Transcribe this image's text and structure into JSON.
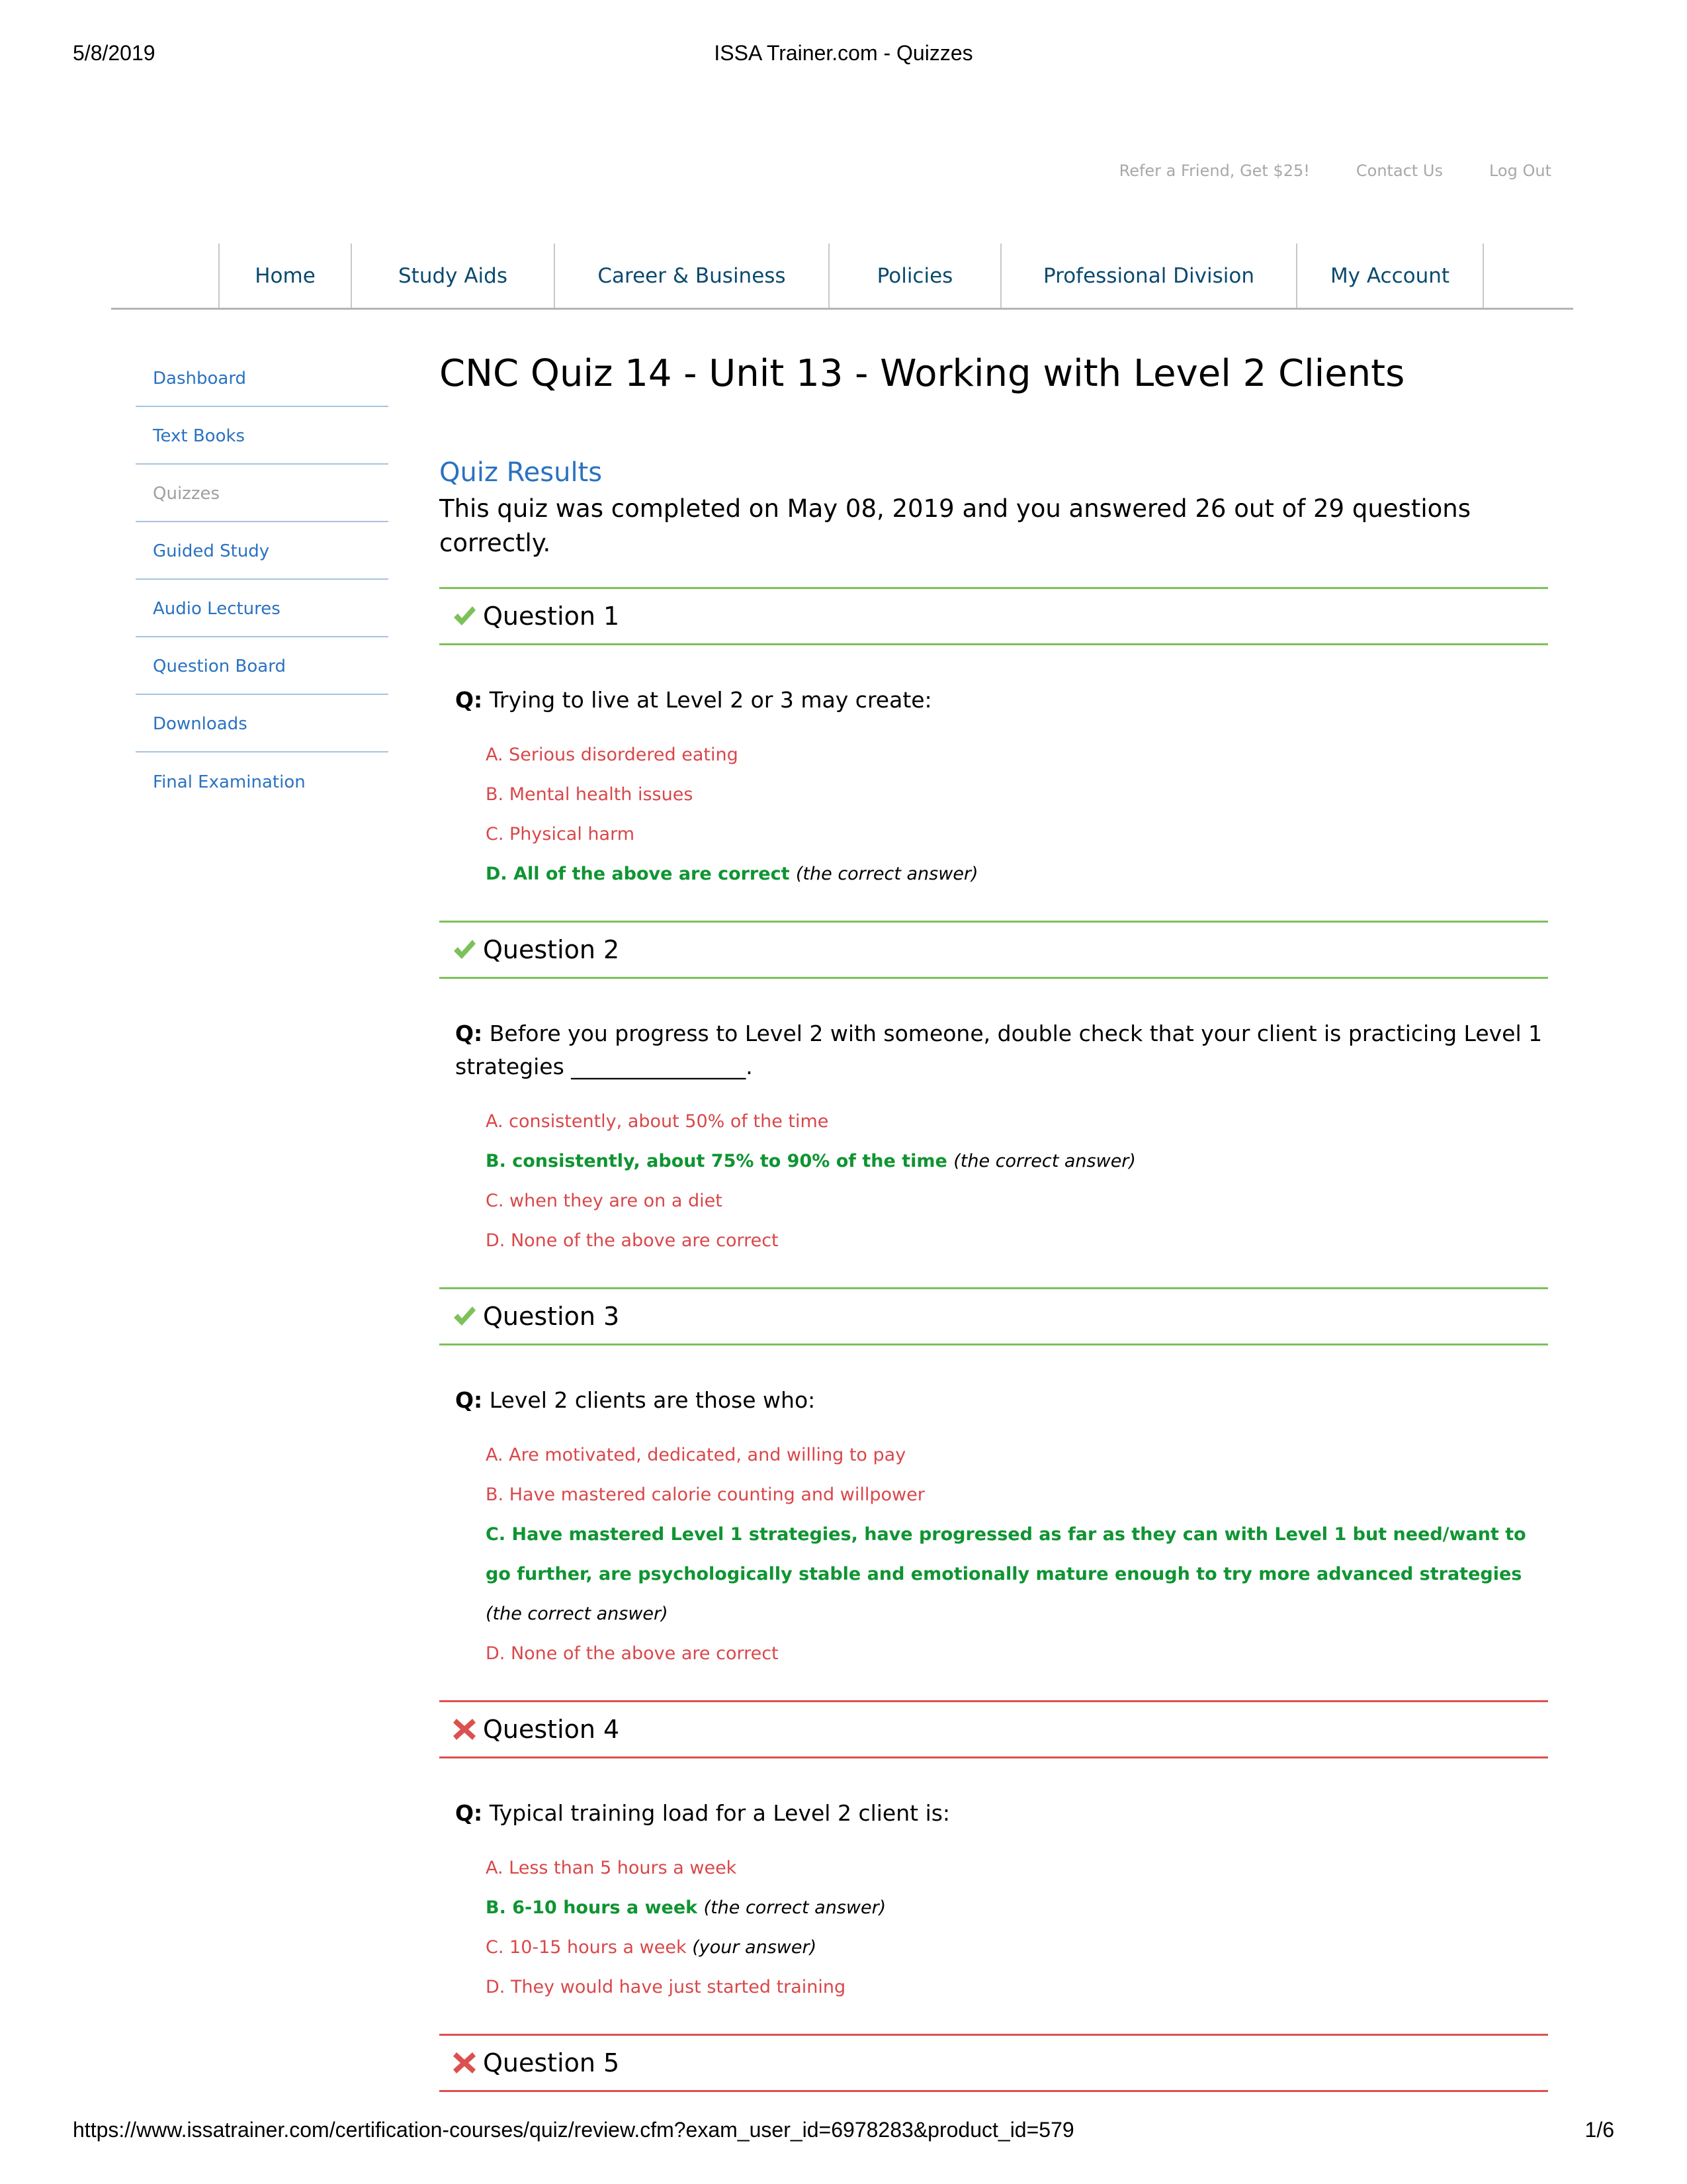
{
  "print": {
    "date": "5/8/2019",
    "title": "ISSA Trainer.com - Quizzes",
    "url": "https://www.issatrainer.com/certification-courses/quiz/review.cfm?exam_user_id=6978283&product_id=579",
    "page": "1/6"
  },
  "utility_links": [
    "Refer a Friend, Get $25!",
    "Contact Us",
    "Log Out"
  ],
  "nav": [
    "Home",
    "Study Aids",
    "Career & Business",
    "Policies",
    "Professional Division",
    "My Account"
  ],
  "sidebar": {
    "items": [
      {
        "label": "Dashboard",
        "active": false
      },
      {
        "label": "Text Books",
        "active": false
      },
      {
        "label": "Quizzes",
        "active": true
      },
      {
        "label": "Guided Study",
        "active": false
      },
      {
        "label": "Audio Lectures",
        "active": false
      },
      {
        "label": "Question Board",
        "active": false
      },
      {
        "label": "Downloads",
        "active": false
      },
      {
        "label": "Final Examination",
        "active": false
      }
    ]
  },
  "page": {
    "title": "CNC Quiz 14 - Unit 13 - Working with Level 2 Clients",
    "results_heading": "Quiz Results",
    "results_summary": "This quiz was completed on May 08, 2019 and you answered 26 out of 29 questions correctly."
  },
  "labels": {
    "q_prefix": "Q:",
    "correct_note": "(the correct answer)",
    "your_note": "(your answer)"
  },
  "colors": {
    "correct": "#7cc15a",
    "incorrect": "#dc5050",
    "right_answer_text": "#0f9432",
    "wrong_answer_text": "#d9474a",
    "link": "#2a72c0",
    "nav": "#0a4a6e"
  },
  "questions": [
    {
      "label": "Question 1",
      "status": "correct",
      "icon": "check-icon",
      "text": "Trying to live at Level 2 or 3 may create:",
      "answers": [
        {
          "text": "A. Serious disordered eating",
          "correct": false,
          "yours": false
        },
        {
          "text": "B. Mental health issues",
          "correct": false,
          "yours": false
        },
        {
          "text": "C. Physical harm",
          "correct": false,
          "yours": false
        },
        {
          "text": "D. All of the above are correct",
          "correct": true,
          "yours": true
        }
      ]
    },
    {
      "label": "Question 2",
      "status": "correct",
      "icon": "check-icon",
      "text": "Before you progress to Level 2 with someone, double check that your client is practicing Level 1 strategies ________________.",
      "answers": [
        {
          "text": "A. consistently, about 50% of the time",
          "correct": false,
          "yours": false
        },
        {
          "text": "B. consistently, about 75% to 90% of the time",
          "correct": true,
          "yours": true
        },
        {
          "text": "C. when they are on a diet",
          "correct": false,
          "yours": false
        },
        {
          "text": "D. None of the above are correct",
          "correct": false,
          "yours": false
        }
      ]
    },
    {
      "label": "Question 3",
      "status": "correct",
      "icon": "check-icon",
      "text": "Level 2 clients are those who:",
      "answers": [
        {
          "text": "A. Are motivated, dedicated, and willing to pay",
          "correct": false,
          "yours": false
        },
        {
          "text": "B. Have mastered calorie counting and willpower",
          "correct": false,
          "yours": false
        },
        {
          "text": "C. Have mastered Level 1 strategies, have progressed as far as they can with Level 1 but need/want to go further, are psychologically stable and emotionally mature enough to try more advanced strategies",
          "correct": true,
          "yours": true
        },
        {
          "text": "D. None of the above are correct",
          "correct": false,
          "yours": false
        }
      ]
    },
    {
      "label": "Question 4",
      "status": "incorrect",
      "icon": "x-icon",
      "text": "Typical training load for a Level 2 client is:",
      "answers": [
        {
          "text": "A. Less than 5 hours a week",
          "correct": false,
          "yours": false
        },
        {
          "text": "B. 6-10 hours a week",
          "correct": true,
          "yours": false
        },
        {
          "text": "C. 10-15 hours a week",
          "correct": false,
          "yours": true
        },
        {
          "text": "D. They would have just started training",
          "correct": false,
          "yours": false
        }
      ]
    },
    {
      "label": "Question 5",
      "status": "incorrect",
      "icon": "x-icon",
      "text": null,
      "answers": []
    }
  ]
}
